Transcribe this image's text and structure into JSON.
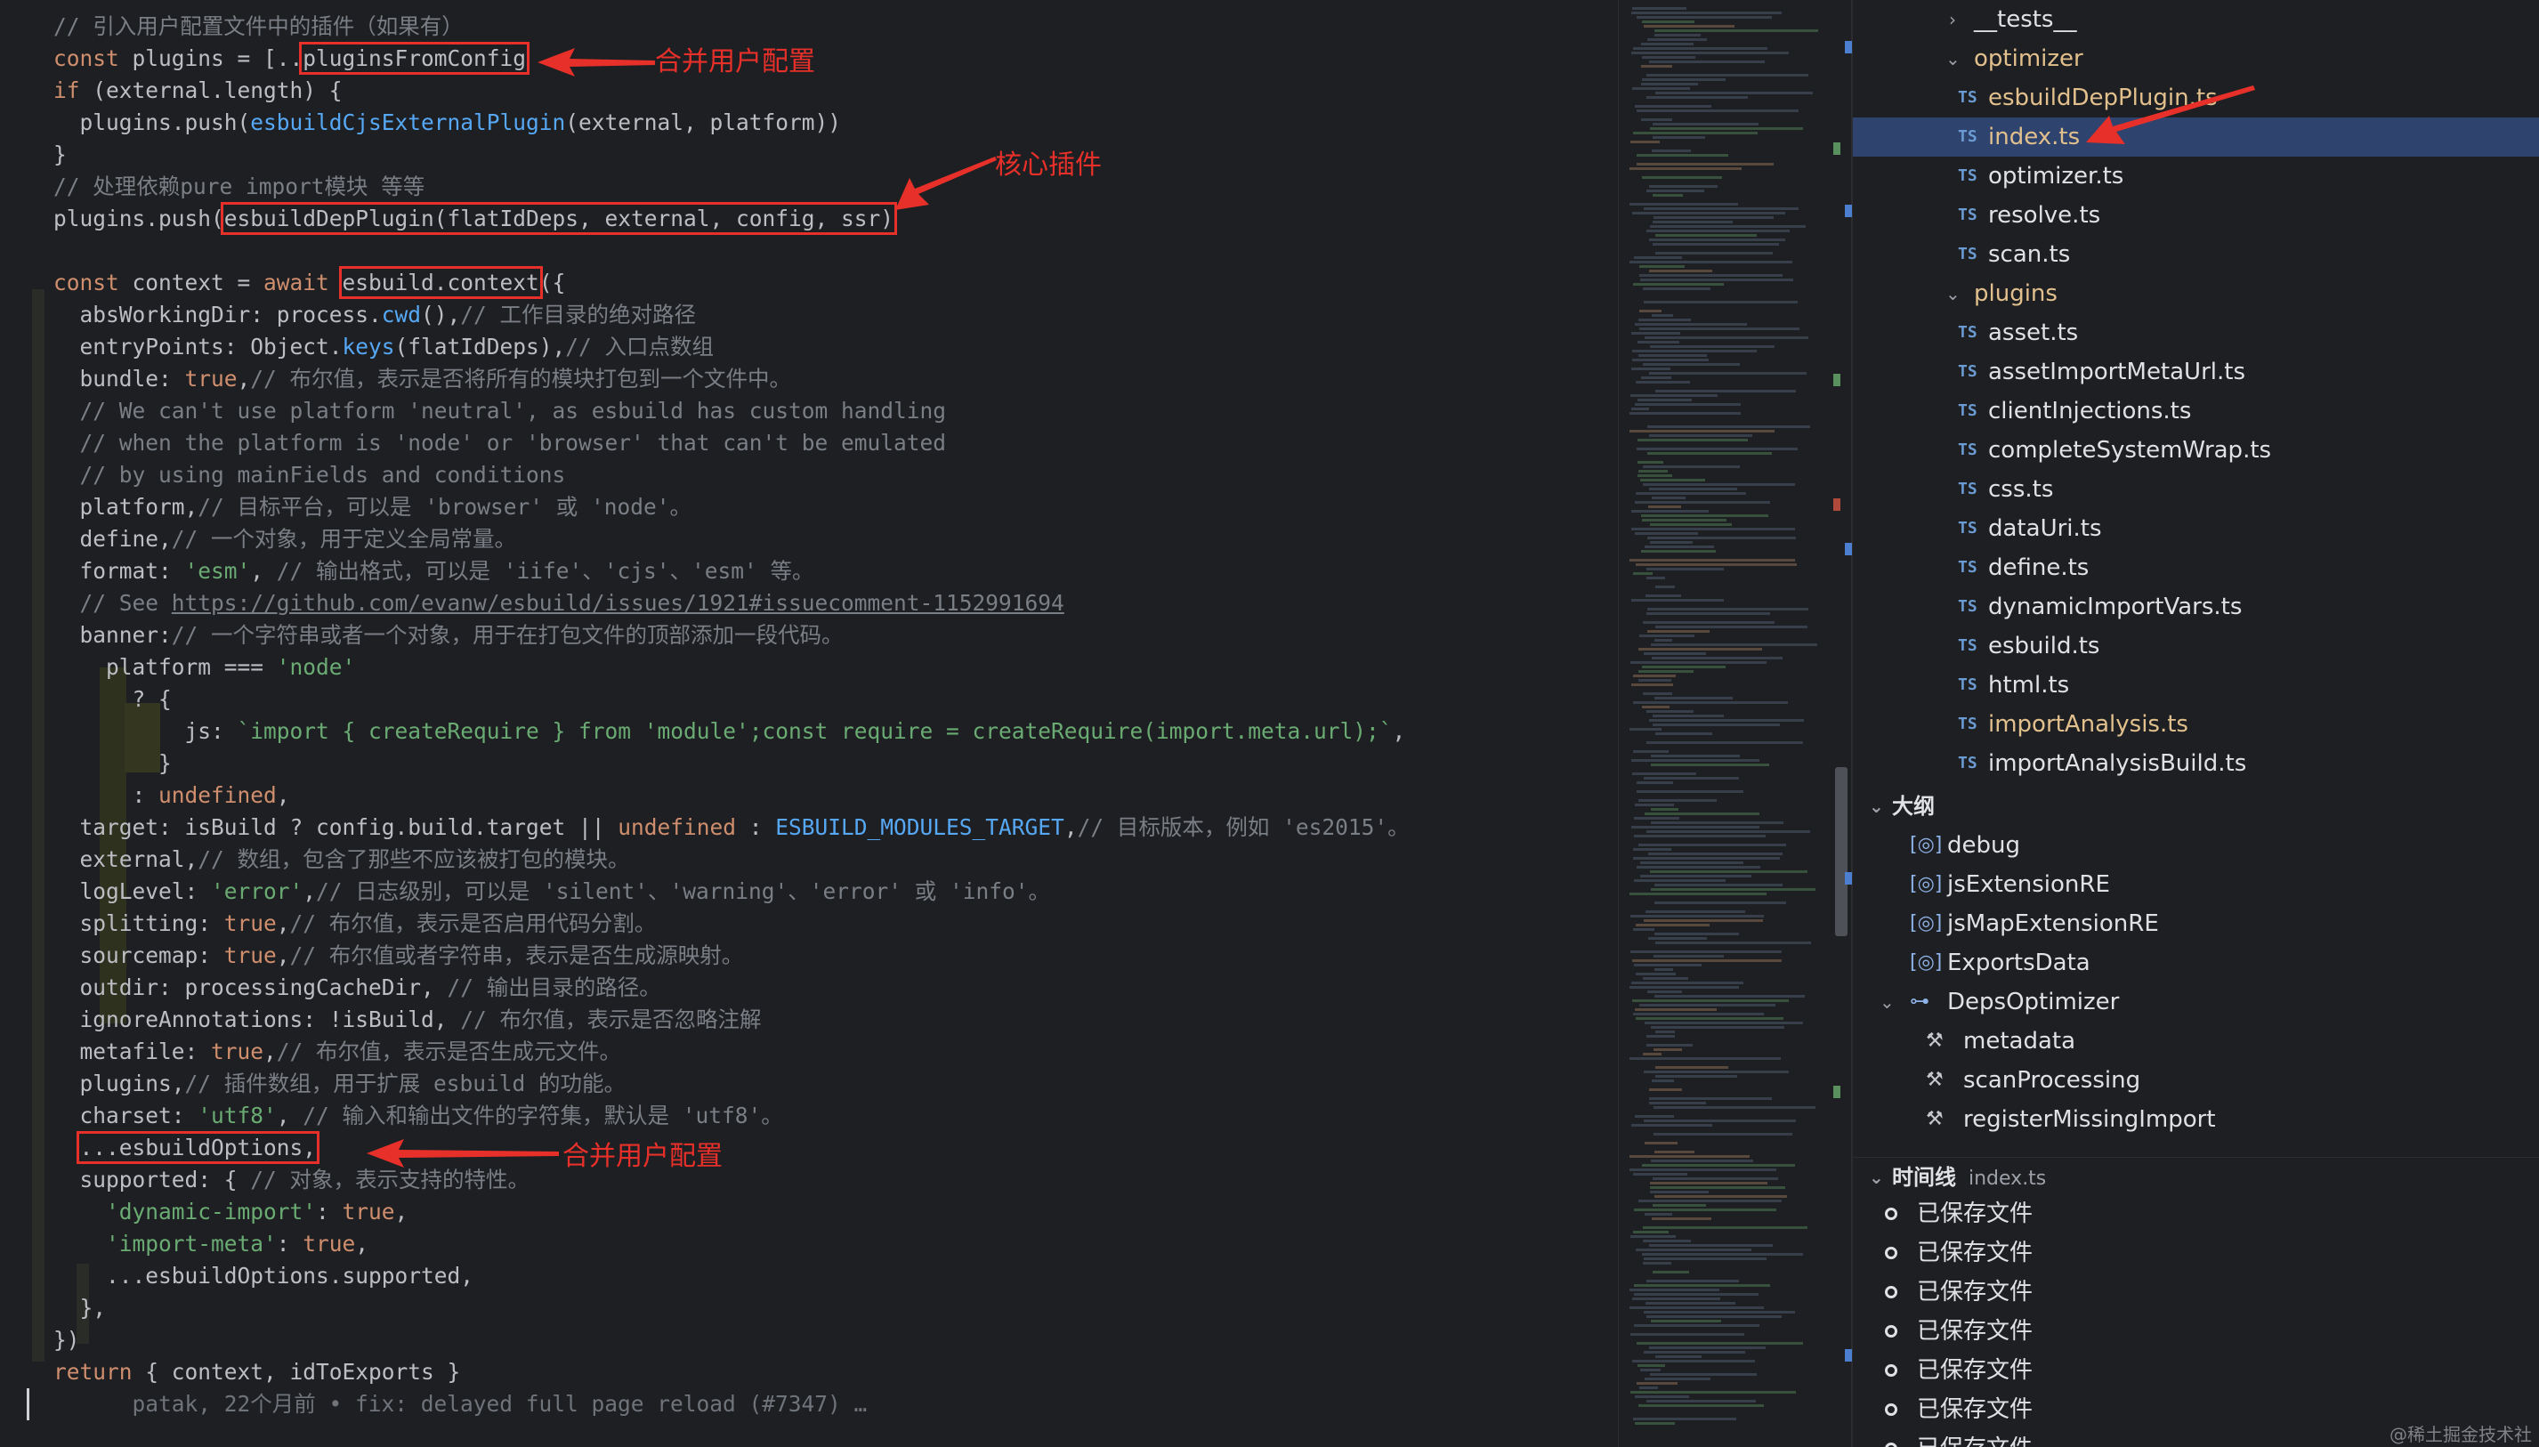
{
  "editor": {
    "lines": [
      {
        "segs": [
          [
            "cm",
            "// 引入用户配置文件中的插件（如果有）"
          ]
        ]
      },
      {
        "segs": [
          [
            "kw",
            "const "
          ],
          [
            "prop",
            "plugins = ["
          ],
          [
            "prop",
            ".."
          ],
          [
            "hl",
            "pluginsFromConfig"
          ]
        ]
      },
      {
        "segs": [
          [
            "kw",
            "if "
          ],
          [
            "prop",
            "(external.length) {"
          ]
        ]
      },
      {
        "segs": [
          [
            "prop",
            "  plugins.push("
          ],
          [
            "fn",
            "esbuildCjsExternalPlugin"
          ],
          [
            "prop",
            "(external, platform))"
          ]
        ]
      },
      {
        "segs": [
          [
            "prop",
            "}"
          ]
        ]
      },
      {
        "segs": [
          [
            "cm",
            "// 处理依赖pure import模块 等等"
          ]
        ]
      },
      {
        "segs": [
          [
            "prop",
            "plugins.push("
          ],
          [
            "hlfn",
            "esbuildDepPlugin(flatIdDeps, external, config, ssr)"
          ]
        ]
      },
      {
        "segs": [
          [
            "prop",
            ""
          ]
        ]
      },
      {
        "segs": [
          [
            "kw",
            "const "
          ],
          [
            "prop",
            "context = "
          ],
          [
            "kw",
            "await "
          ],
          [
            "hlprop",
            "esbuild.context"
          ],
          [
            "prop",
            "({"
          ]
        ]
      },
      {
        "segs": [
          [
            "prop",
            "  absWorkingDir: process."
          ],
          [
            "fn",
            "cwd"
          ],
          [
            "prop",
            "(),"
          ],
          [
            "cm",
            "// 工作目录的绝对路径"
          ]
        ]
      },
      {
        "segs": [
          [
            "prop",
            "  entryPoints: Object."
          ],
          [
            "fn",
            "keys"
          ],
          [
            "prop",
            "(flatIdDeps),"
          ],
          [
            "cm",
            "// 入口点数组"
          ]
        ]
      },
      {
        "segs": [
          [
            "prop",
            "  bundle: "
          ],
          [
            "kw",
            "true"
          ],
          [
            "prop",
            ","
          ],
          [
            "cm",
            "// 布尔值，表示是否将所有的模块打包到一个文件中。"
          ]
        ]
      },
      {
        "segs": [
          [
            "cm",
            "  // We can't use platform 'neutral', as esbuild has custom handling"
          ]
        ]
      },
      {
        "segs": [
          [
            "cm",
            "  // when the platform is 'node' or 'browser' that can't be emulated"
          ]
        ]
      },
      {
        "segs": [
          [
            "cm",
            "  // by using mainFields and conditions"
          ]
        ]
      },
      {
        "segs": [
          [
            "prop",
            "  platform,"
          ],
          [
            "cm",
            "// 目标平台，可以是 'browser' 或 'node'。"
          ]
        ]
      },
      {
        "segs": [
          [
            "prop",
            "  define,"
          ],
          [
            "cm",
            "// 一个对象，用于定义全局常量。"
          ]
        ]
      },
      {
        "segs": [
          [
            "prop",
            "  format: "
          ],
          [
            "str",
            "'esm'"
          ],
          [
            "prop",
            ", "
          ],
          [
            "cm",
            "// 输出格式，可以是 'iife'、'cjs'、'esm' 等。"
          ]
        ]
      },
      {
        "segs": [
          [
            "cm",
            "  // See "
          ],
          [
            "link",
            "https://github.com/evanw/esbuild/issues/1921#issuecomment-1152991694"
          ]
        ]
      },
      {
        "segs": [
          [
            "prop",
            "  banner:"
          ],
          [
            "cm",
            "// 一个字符串或者一个对象，用于在打包文件的顶部添加一段代码。"
          ]
        ]
      },
      {
        "segs": [
          [
            "prop",
            "    platform === "
          ],
          [
            "str",
            "'node'"
          ]
        ]
      },
      {
        "segs": [
          [
            "prop",
            "      ? {"
          ]
        ]
      },
      {
        "segs": [
          [
            "prop",
            "          js: "
          ],
          [
            "str",
            "`import { createRequire } from 'module';const require = createRequire(import.meta.url);`"
          ],
          [
            "prop",
            ","
          ]
        ]
      },
      {
        "segs": [
          [
            "prop",
            "        }"
          ]
        ]
      },
      {
        "segs": [
          [
            "prop",
            "      : "
          ],
          [
            "kw",
            "undefined"
          ],
          [
            "prop",
            ","
          ]
        ]
      },
      {
        "segs": [
          [
            "prop",
            "  target: isBuild ? config.build.target || "
          ],
          [
            "kw",
            "undefined"
          ],
          [
            "prop",
            " : "
          ],
          [
            "fn",
            "ESBUILD_MODULES_TARGET"
          ],
          [
            "prop",
            ","
          ],
          [
            "cm",
            "// 目标版本，例如 'es2015'。"
          ]
        ]
      },
      {
        "segs": [
          [
            "prop",
            "  external,"
          ],
          [
            "cm",
            "// 数组，包含了那些不应该被打包的模块。"
          ]
        ]
      },
      {
        "segs": [
          [
            "prop",
            "  logLevel: "
          ],
          [
            "str",
            "'error'"
          ],
          [
            "prop",
            ","
          ],
          [
            "cm",
            "// 日志级别，可以是 'silent'、'warning'、'error' 或 'info'。"
          ]
        ]
      },
      {
        "segs": [
          [
            "prop",
            "  splitting: "
          ],
          [
            "kw",
            "true"
          ],
          [
            "prop",
            ","
          ],
          [
            "cm",
            "// 布尔值，表示是否启用代码分割。"
          ]
        ]
      },
      {
        "segs": [
          [
            "prop",
            "  sourcemap: "
          ],
          [
            "kw",
            "true"
          ],
          [
            "prop",
            ","
          ],
          [
            "cm",
            "// 布尔值或者字符串，表示是否生成源映射。"
          ]
        ]
      },
      {
        "segs": [
          [
            "prop",
            "  outdir: processingCacheDir, "
          ],
          [
            "cm",
            "// 输出目录的路径。"
          ]
        ]
      },
      {
        "segs": [
          [
            "prop",
            "  ignoreAnnotations: !isBuild, "
          ],
          [
            "cm",
            "// 布尔值，表示是否忽略注解"
          ]
        ]
      },
      {
        "segs": [
          [
            "prop",
            "  metafile: "
          ],
          [
            "kw",
            "true"
          ],
          [
            "prop",
            ","
          ],
          [
            "cm",
            "// 布尔值，表示是否生成元文件。"
          ]
        ]
      },
      {
        "segs": [
          [
            "prop",
            "  plugins,"
          ],
          [
            "cm",
            "// 插件数组，用于扩展 esbuild 的功能。"
          ]
        ]
      },
      {
        "segs": [
          [
            "prop",
            "  charset: "
          ],
          [
            "str",
            "'utf8'"
          ],
          [
            "prop",
            ", "
          ],
          [
            "cm",
            "// 输入和输出文件的字符集，默认是 'utf8'。"
          ]
        ]
      },
      {
        "segs": [
          [
            "prop",
            "  "
          ],
          [
            "hlprop",
            "...esbuildOptions,"
          ]
        ]
      },
      {
        "segs": [
          [
            "prop",
            "  supported: { "
          ],
          [
            "cm",
            "// 对象，表示支持的特性。"
          ]
        ]
      },
      {
        "segs": [
          [
            "str",
            "    'dynamic-import'"
          ],
          [
            "prop",
            ": "
          ],
          [
            "kw",
            "true"
          ],
          [
            "prop",
            ","
          ]
        ]
      },
      {
        "segs": [
          [
            "str",
            "    'import-meta'"
          ],
          [
            "prop",
            ": "
          ],
          [
            "kw",
            "true"
          ],
          [
            "prop",
            ","
          ]
        ]
      },
      {
        "segs": [
          [
            "prop",
            "    ...esbuildOptions.supported,"
          ]
        ]
      },
      {
        "segs": [
          [
            "prop",
            "  },"
          ]
        ]
      },
      {
        "segs": [
          [
            "prop",
            "})"
          ]
        ]
      },
      {
        "segs": [
          [
            "kw",
            "return "
          ],
          [
            "prop",
            "{ context, idToExports }"
          ]
        ]
      },
      {
        "segs": [
          [
            "dim",
            "      patak, 22个月前 • fix: delayed full page reload (#7347) …"
          ]
        ]
      }
    ]
  },
  "annotations": {
    "merge_user_config_1": "合并用户配置",
    "core_plugin": "核心插件",
    "merge_user_config_2": "合并用户配置"
  },
  "explorer": {
    "tests_folder": "__tests__",
    "optimizer_folder": "optimizer",
    "optimizer_files": [
      "esbuildDepPlugin.ts",
      "index.ts",
      "optimizer.ts",
      "resolve.ts",
      "scan.ts"
    ],
    "plugins_folder": "plugins",
    "plugins_files": [
      "asset.ts",
      "assetImportMetaUrl.ts",
      "clientInjections.ts",
      "completeSystemWrap.ts",
      "css.ts",
      "dataUri.ts",
      "define.ts",
      "dynamicImportVars.ts",
      "esbuild.ts",
      "html.ts",
      "importAnalysis.ts",
      "importAnalysisBuild.ts"
    ],
    "ts_badge": "TS"
  },
  "outline": {
    "title": "大纲",
    "items": [
      {
        "label": "debug",
        "icon": "variable-icon"
      },
      {
        "label": "jsExtensionRE",
        "icon": "variable-icon"
      },
      {
        "label": "jsMapExtensionRE",
        "icon": "variable-icon"
      },
      {
        "label": "ExportsData",
        "icon": "variable-icon"
      },
      {
        "label": "DepsOptimizer",
        "icon": "interface-icon"
      },
      {
        "label": "metadata",
        "icon": "property-icon"
      },
      {
        "label": "scanProcessing",
        "icon": "property-icon"
      },
      {
        "label": "registerMissingImport",
        "icon": "property-icon"
      }
    ]
  },
  "timeline": {
    "title": "时间线",
    "file": "index.ts",
    "entries": [
      "已保存文件",
      "已保存文件",
      "已保存文件",
      "已保存文件",
      "已保存文件",
      "已保存文件",
      "已保存文件"
    ]
  },
  "watermark": "@稀土掘金技术社区",
  "colors": {
    "annotation": "#e8302a",
    "selection": "#2e436e",
    "modified": "#e2c08d"
  }
}
